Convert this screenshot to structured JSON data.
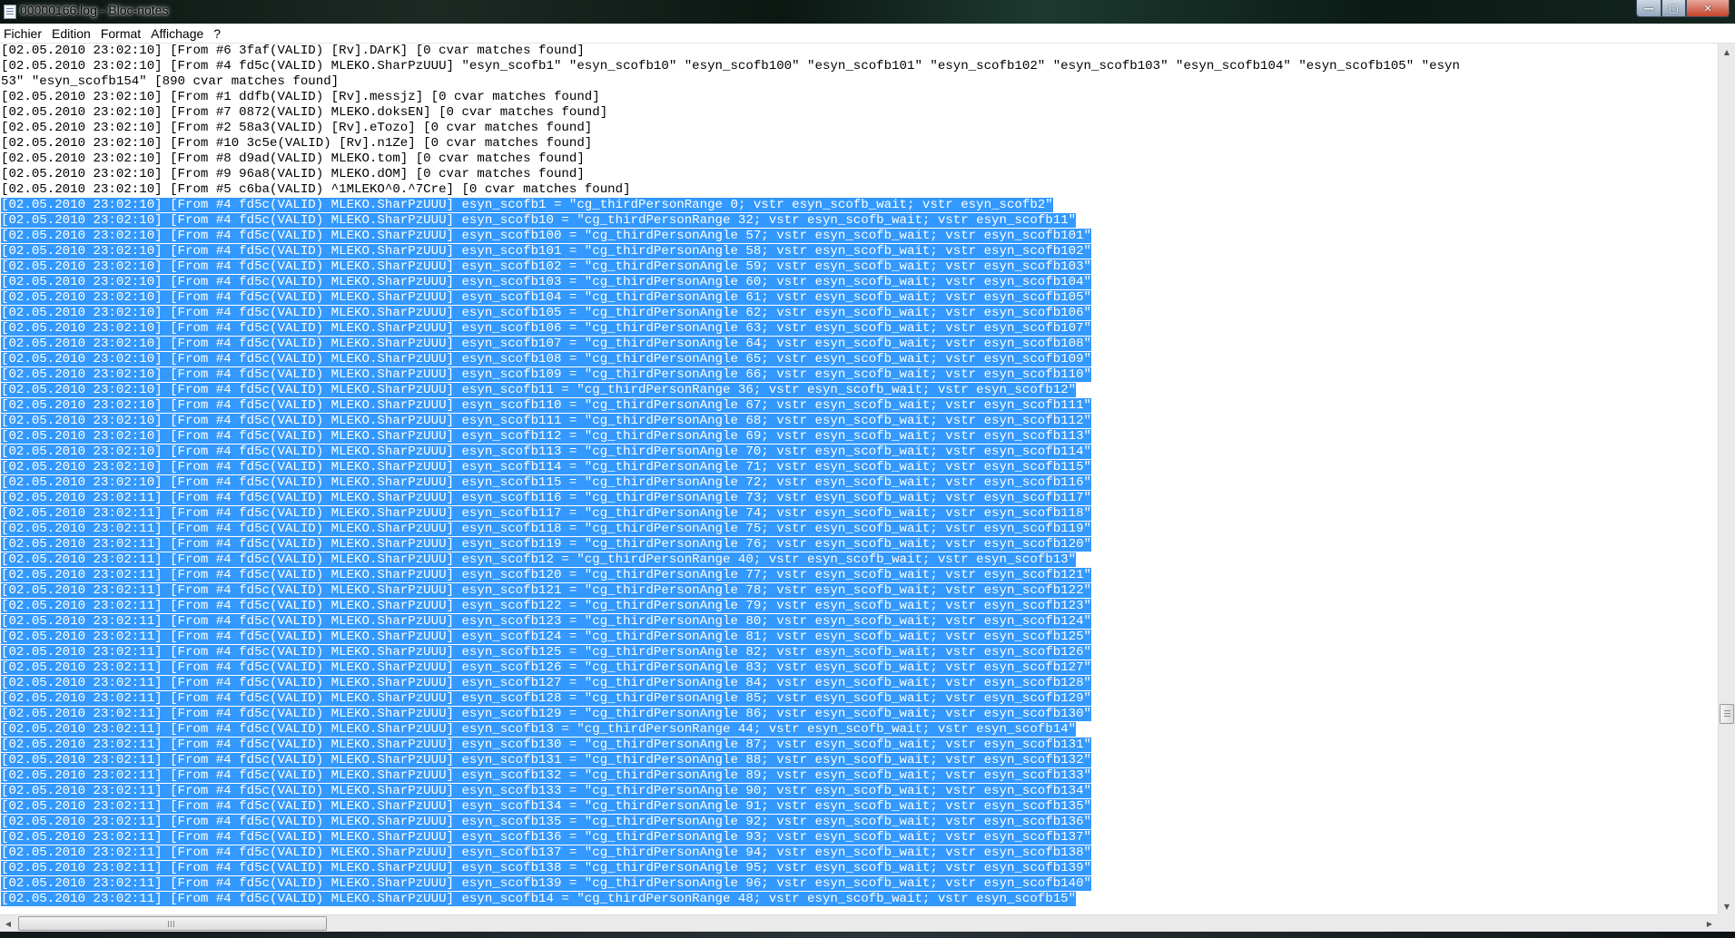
{
  "window": {
    "title": "00000166.log - Bloc-notes",
    "buttons": {
      "minimize": "—",
      "maximize": "□",
      "close": "✕"
    }
  },
  "menu": [
    "Fichier",
    "Edition",
    "Format",
    "Affichage",
    "?"
  ],
  "lines": [
    {
      "text": "[02.05.2010 23:02:10] [From #6 3faf(VALID) [Rv].DArK] [0 cvar matches found]",
      "selected": false
    },
    {
      "text": "[02.05.2010 23:02:10] [From #4 fd5c(VALID) MLEKO.SharPzUUU] \"esyn_scofb1\" \"esyn_scofb10\" \"esyn_scofb100\" \"esyn_scofb101\" \"esyn_scofb102\" \"esyn_scofb103\" \"esyn_scofb104\" \"esyn_scofb105\" \"esyn",
      "selected": false
    },
    {
      "text": "53\" \"esyn_scofb154\" [890 cvar matches found]",
      "selected": false
    },
    {
      "text": "[02.05.2010 23:02:10] [From #1 ddfb(VALID) [Rv].messjz] [0 cvar matches found]",
      "selected": false
    },
    {
      "text": "[02.05.2010 23:02:10] [From #7 0872(VALID) MLEKO.doksEN] [0 cvar matches found]",
      "selected": false
    },
    {
      "text": "[02.05.2010 23:02:10] [From #2 58a3(VALID) [Rv].eTozo] [0 cvar matches found]",
      "selected": false
    },
    {
      "text": "[02.05.2010 23:02:10] [From #10 3c5e(VALID) [Rv].n1Ze] [0 cvar matches found]",
      "selected": false
    },
    {
      "text": "[02.05.2010 23:02:10] [From #8 d9ad(VALID) MLEKO.tom] [0 cvar matches found]",
      "selected": false
    },
    {
      "text": "[02.05.2010 23:02:10] [From #9 96a8(VALID) MLEKO.dOM] [0 cvar matches found]",
      "selected": false
    },
    {
      "text": "[02.05.2010 23:02:10] [From #5 c6ba(VALID) ^1MLEKO^0.^7Cre] [0 cvar matches found]",
      "selected": false
    },
    {
      "text": "[02.05.2010 23:02:10] [From #4 fd5c(VALID) MLEKO.SharPzUUU] esyn_scofb1 = \"cg_thirdPersonRange 0; vstr esyn_scofb_wait; vstr esyn_scofb2\"",
      "selected": true
    },
    {
      "text": "[02.05.2010 23:02:10] [From #4 fd5c(VALID) MLEKO.SharPzUUU] esyn_scofb10 = \"cg_thirdPersonRange 32; vstr esyn_scofb_wait; vstr esyn_scofb11\"",
      "selected": true
    },
    {
      "text": "[02.05.2010 23:02:10] [From #4 fd5c(VALID) MLEKO.SharPzUUU] esyn_scofb100 = \"cg_thirdPersonAngle 57; vstr esyn_scofb_wait; vstr esyn_scofb101\"",
      "selected": true
    },
    {
      "text": "[02.05.2010 23:02:10] [From #4 fd5c(VALID) MLEKO.SharPzUUU] esyn_scofb101 = \"cg_thirdPersonAngle 58; vstr esyn_scofb_wait; vstr esyn_scofb102\"",
      "selected": true
    },
    {
      "text": "[02.05.2010 23:02:10] [From #4 fd5c(VALID) MLEKO.SharPzUUU] esyn_scofb102 = \"cg_thirdPersonAngle 59; vstr esyn_scofb_wait; vstr esyn_scofb103\"",
      "selected": true
    },
    {
      "text": "[02.05.2010 23:02:10] [From #4 fd5c(VALID) MLEKO.SharPzUUU] esyn_scofb103 = \"cg_thirdPersonAngle 60; vstr esyn_scofb_wait; vstr esyn_scofb104\"",
      "selected": true
    },
    {
      "text": "[02.05.2010 23:02:10] [From #4 fd5c(VALID) MLEKO.SharPzUUU] esyn_scofb104 = \"cg_thirdPersonAngle 61; vstr esyn_scofb_wait; vstr esyn_scofb105\"",
      "selected": true
    },
    {
      "text": "[02.05.2010 23:02:10] [From #4 fd5c(VALID) MLEKO.SharPzUUU] esyn_scofb105 = \"cg_thirdPersonAngle 62; vstr esyn_scofb_wait; vstr esyn_scofb106\"",
      "selected": true
    },
    {
      "text": "[02.05.2010 23:02:10] [From #4 fd5c(VALID) MLEKO.SharPzUUU] esyn_scofb106 = \"cg_thirdPersonAngle 63; vstr esyn_scofb_wait; vstr esyn_scofb107\"",
      "selected": true
    },
    {
      "text": "[02.05.2010 23:02:10] [From #4 fd5c(VALID) MLEKO.SharPzUUU] esyn_scofb107 = \"cg_thirdPersonAngle 64; vstr esyn_scofb_wait; vstr esyn_scofb108\"",
      "selected": true
    },
    {
      "text": "[02.05.2010 23:02:10] [From #4 fd5c(VALID) MLEKO.SharPzUUU] esyn_scofb108 = \"cg_thirdPersonAngle 65; vstr esyn_scofb_wait; vstr esyn_scofb109\"",
      "selected": true
    },
    {
      "text": "[02.05.2010 23:02:10] [From #4 fd5c(VALID) MLEKO.SharPzUUU] esyn_scofb109 = \"cg_thirdPersonAngle 66; vstr esyn_scofb_wait; vstr esyn_scofb110\"",
      "selected": true
    },
    {
      "text": "[02.05.2010 23:02:10] [From #4 fd5c(VALID) MLEKO.SharPzUUU] esyn_scofb11 = \"cg_thirdPersonRange 36; vstr esyn_scofb_wait; vstr esyn_scofb12\"",
      "selected": true
    },
    {
      "text": "[02.05.2010 23:02:10] [From #4 fd5c(VALID) MLEKO.SharPzUUU] esyn_scofb110 = \"cg_thirdPersonAngle 67; vstr esyn_scofb_wait; vstr esyn_scofb111\"",
      "selected": true
    },
    {
      "text": "[02.05.2010 23:02:10] [From #4 fd5c(VALID) MLEKO.SharPzUUU] esyn_scofb111 = \"cg_thirdPersonAngle 68; vstr esyn_scofb_wait; vstr esyn_scofb112\"",
      "selected": true
    },
    {
      "text": "[02.05.2010 23:02:10] [From #4 fd5c(VALID) MLEKO.SharPzUUU] esyn_scofb112 = \"cg_thirdPersonAngle 69; vstr esyn_scofb_wait; vstr esyn_scofb113\"",
      "selected": true
    },
    {
      "text": "[02.05.2010 23:02:10] [From #4 fd5c(VALID) MLEKO.SharPzUUU] esyn_scofb113 = \"cg_thirdPersonAngle 70; vstr esyn_scofb_wait; vstr esyn_scofb114\"",
      "selected": true
    },
    {
      "text": "[02.05.2010 23:02:10] [From #4 fd5c(VALID) MLEKO.SharPzUUU] esyn_scofb114 = \"cg_thirdPersonAngle 71; vstr esyn_scofb_wait; vstr esyn_scofb115\"",
      "selected": true
    },
    {
      "text": "[02.05.2010 23:02:10] [From #4 fd5c(VALID) MLEKO.SharPzUUU] esyn_scofb115 = \"cg_thirdPersonAngle 72; vstr esyn_scofb_wait; vstr esyn_scofb116\"",
      "selected": true
    },
    {
      "text": "[02.05.2010 23:02:11] [From #4 fd5c(VALID) MLEKO.SharPzUUU] esyn_scofb116 = \"cg_thirdPersonAngle 73; vstr esyn_scofb_wait; vstr esyn_scofb117\"",
      "selected": true
    },
    {
      "text": "[02.05.2010 23:02:11] [From #4 fd5c(VALID) MLEKO.SharPzUUU] esyn_scofb117 = \"cg_thirdPersonAngle 74; vstr esyn_scofb_wait; vstr esyn_scofb118\"",
      "selected": true
    },
    {
      "text": "[02.05.2010 23:02:11] [From #4 fd5c(VALID) MLEKO.SharPzUUU] esyn_scofb118 = \"cg_thirdPersonAngle 75; vstr esyn_scofb_wait; vstr esyn_scofb119\"",
      "selected": true
    },
    {
      "text": "[02.05.2010 23:02:11] [From #4 fd5c(VALID) MLEKO.SharPzUUU] esyn_scofb119 = \"cg_thirdPersonAngle 76; vstr esyn_scofb_wait; vstr esyn_scofb120\"",
      "selected": true
    },
    {
      "text": "[02.05.2010 23:02:11] [From #4 fd5c(VALID) MLEKO.SharPzUUU] esyn_scofb12 = \"cg_thirdPersonRange 40; vstr esyn_scofb_wait; vstr esyn_scofb13\"",
      "selected": true
    },
    {
      "text": "[02.05.2010 23:02:11] [From #4 fd5c(VALID) MLEKO.SharPzUUU] esyn_scofb120 = \"cg_thirdPersonAngle 77; vstr esyn_scofb_wait; vstr esyn_scofb121\"",
      "selected": true
    },
    {
      "text": "[02.05.2010 23:02:11] [From #4 fd5c(VALID) MLEKO.SharPzUUU] esyn_scofb121 = \"cg_thirdPersonAngle 78; vstr esyn_scofb_wait; vstr esyn_scofb122\"",
      "selected": true
    },
    {
      "text": "[02.05.2010 23:02:11] [From #4 fd5c(VALID) MLEKO.SharPzUUU] esyn_scofb122 = \"cg_thirdPersonAngle 79; vstr esyn_scofb_wait; vstr esyn_scofb123\"",
      "selected": true
    },
    {
      "text": "[02.05.2010 23:02:11] [From #4 fd5c(VALID) MLEKO.SharPzUUU] esyn_scofb123 = \"cg_thirdPersonAngle 80; vstr esyn_scofb_wait; vstr esyn_scofb124\"",
      "selected": true
    },
    {
      "text": "[02.05.2010 23:02:11] [From #4 fd5c(VALID) MLEKO.SharPzUUU] esyn_scofb124 = \"cg_thirdPersonAngle 81; vstr esyn_scofb_wait; vstr esyn_scofb125\"",
      "selected": true
    },
    {
      "text": "[02.05.2010 23:02:11] [From #4 fd5c(VALID) MLEKO.SharPzUUU] esyn_scofb125 = \"cg_thirdPersonAngle 82; vstr esyn_scofb_wait; vstr esyn_scofb126\"",
      "selected": true
    },
    {
      "text": "[02.05.2010 23:02:11] [From #4 fd5c(VALID) MLEKO.SharPzUUU] esyn_scofb126 = \"cg_thirdPersonAngle 83; vstr esyn_scofb_wait; vstr esyn_scofb127\"",
      "selected": true
    },
    {
      "text": "[02.05.2010 23:02:11] [From #4 fd5c(VALID) MLEKO.SharPzUUU] esyn_scofb127 = \"cg_thirdPersonAngle 84; vstr esyn_scofb_wait; vstr esyn_scofb128\"",
      "selected": true
    },
    {
      "text": "[02.05.2010 23:02:11] [From #4 fd5c(VALID) MLEKO.SharPzUUU] esyn_scofb128 = \"cg_thirdPersonAngle 85; vstr esyn_scofb_wait; vstr esyn_scofb129\"",
      "selected": true
    },
    {
      "text": "[02.05.2010 23:02:11] [From #4 fd5c(VALID) MLEKO.SharPzUUU] esyn_scofb129 = \"cg_thirdPersonAngle 86; vstr esyn_scofb_wait; vstr esyn_scofb130\"",
      "selected": true
    },
    {
      "text": "[02.05.2010 23:02:11] [From #4 fd5c(VALID) MLEKO.SharPzUUU] esyn_scofb13 = \"cg_thirdPersonRange 44; vstr esyn_scofb_wait; vstr esyn_scofb14\"",
      "selected": true
    },
    {
      "text": "[02.05.2010 23:02:11] [From #4 fd5c(VALID) MLEKO.SharPzUUU] esyn_scofb130 = \"cg_thirdPersonAngle 87; vstr esyn_scofb_wait; vstr esyn_scofb131\"",
      "selected": true
    },
    {
      "text": "[02.05.2010 23:02:11] [From #4 fd5c(VALID) MLEKO.SharPzUUU] esyn_scofb131 = \"cg_thirdPersonAngle 88; vstr esyn_scofb_wait; vstr esyn_scofb132\"",
      "selected": true
    },
    {
      "text": "[02.05.2010 23:02:11] [From #4 fd5c(VALID) MLEKO.SharPzUUU] esyn_scofb132 = \"cg_thirdPersonAngle 89; vstr esyn_scofb_wait; vstr esyn_scofb133\"",
      "selected": true
    },
    {
      "text": "[02.05.2010 23:02:11] [From #4 fd5c(VALID) MLEKO.SharPzUUU] esyn_scofb133 = \"cg_thirdPersonAngle 90; vstr esyn_scofb_wait; vstr esyn_scofb134\"",
      "selected": true
    },
    {
      "text": "[02.05.2010 23:02:11] [From #4 fd5c(VALID) MLEKO.SharPzUUU] esyn_scofb134 = \"cg_thirdPersonAngle 91; vstr esyn_scofb_wait; vstr esyn_scofb135\"",
      "selected": true
    },
    {
      "text": "[02.05.2010 23:02:11] [From #4 fd5c(VALID) MLEKO.SharPzUUU] esyn_scofb135 = \"cg_thirdPersonAngle 92; vstr esyn_scofb_wait; vstr esyn_scofb136\"",
      "selected": true
    },
    {
      "text": "[02.05.2010 23:02:11] [From #4 fd5c(VALID) MLEKO.SharPzUUU] esyn_scofb136 = \"cg_thirdPersonAngle 93; vstr esyn_scofb_wait; vstr esyn_scofb137\"",
      "selected": true
    },
    {
      "text": "[02.05.2010 23:02:11] [From #4 fd5c(VALID) MLEKO.SharPzUUU] esyn_scofb137 = \"cg_thirdPersonAngle 94; vstr esyn_scofb_wait; vstr esyn_scofb138\"",
      "selected": true
    },
    {
      "text": "[02.05.2010 23:02:11] [From #4 fd5c(VALID) MLEKO.SharPzUUU] esyn_scofb138 = \"cg_thirdPersonAngle 95; vstr esyn_scofb_wait; vstr esyn_scofb139\"",
      "selected": true
    },
    {
      "text": "[02.05.2010 23:02:11] [From #4 fd5c(VALID) MLEKO.SharPzUUU] esyn_scofb139 = \"cg_thirdPersonAngle 96; vstr esyn_scofb_wait; vstr esyn_scofb140\"",
      "selected": true
    },
    {
      "text": "[02.05.2010 23:02:11] [From #4 fd5c(VALID) MLEKO.SharPzUUU] esyn_scofb14 = \"cg_thirdPersonRange 48; vstr esyn_scofb_wait; vstr esyn_scofb15\"",
      "selected": true
    }
  ],
  "colors": {
    "selection": "#3399ff",
    "selection_text": "#ffffff",
    "text": "#000000",
    "background": "#ffffff"
  },
  "icons": {
    "app": "notepad-icon",
    "scroll_up": "▲",
    "scroll_down": "▼",
    "scroll_left": "◀",
    "scroll_right": "▶"
  }
}
